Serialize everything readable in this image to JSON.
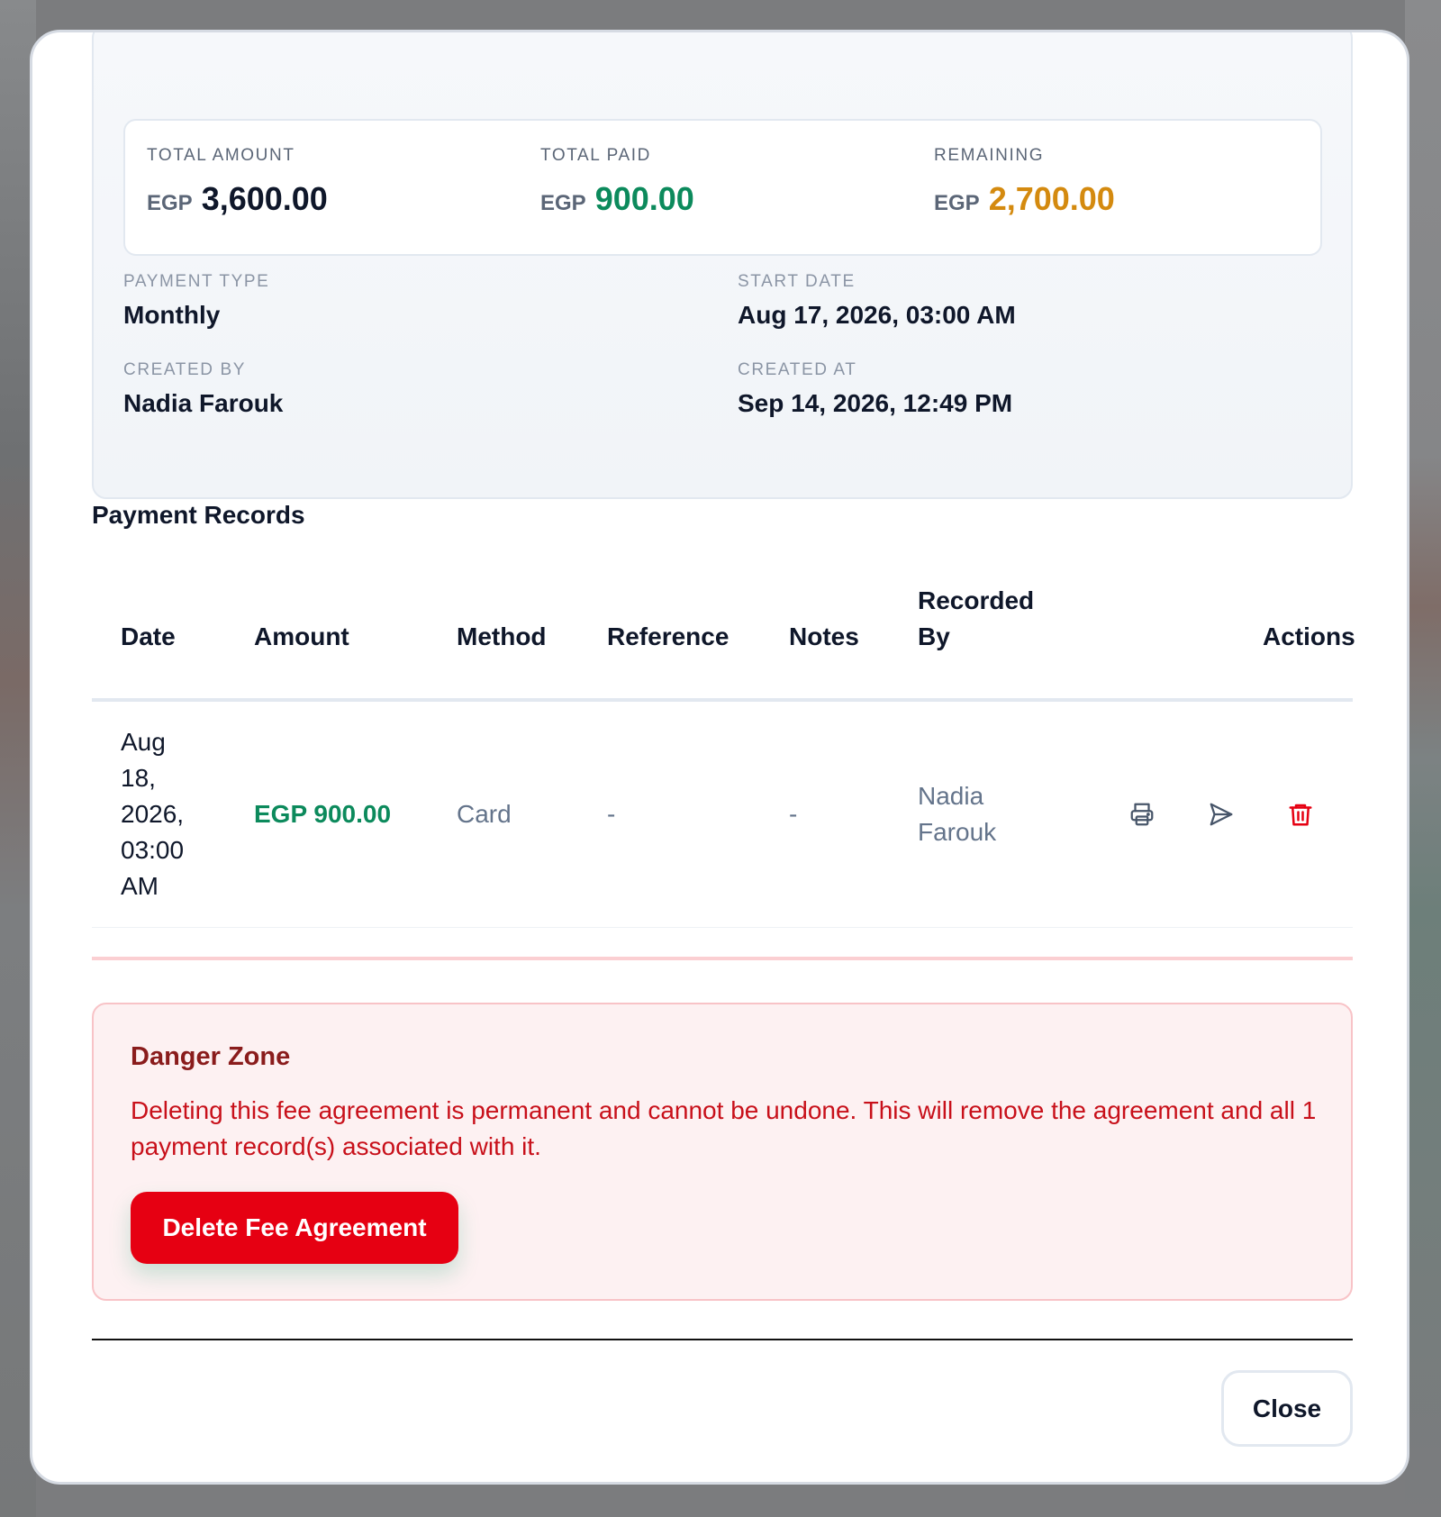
{
  "summary": {
    "totals": [
      {
        "label": "TOTAL AMOUNT",
        "currency": "EGP",
        "value": "3,600.00",
        "tone": "dark"
      },
      {
        "label": "TOTAL PAID",
        "currency": "EGP",
        "value": "900.00",
        "tone": "green"
      },
      {
        "label": "REMAINING",
        "currency": "EGP",
        "value": "2,700.00",
        "tone": "amber"
      }
    ],
    "payment_type": {
      "label": "PAYMENT TYPE",
      "value": "Monthly"
    },
    "start_date": {
      "label": "START DATE",
      "value": "Aug 17, 2026, 03:00 AM"
    },
    "created_by": {
      "label": "CREATED BY",
      "value": "Nadia Farouk"
    },
    "created_at": {
      "label": "CREATED AT",
      "value": "Sep 14, 2026, 12:49 PM"
    }
  },
  "payment_records": {
    "title": "Payment Records",
    "columns": [
      "Date",
      "Amount",
      "Method",
      "Reference",
      "Notes",
      "Recorded By",
      "Actions"
    ],
    "rows": [
      {
        "date": "Aug 18, 2026, 03:00 AM",
        "amount": "EGP 900.00",
        "method": "Card",
        "reference": "-",
        "notes": "-",
        "recorded_by": "Nadia Farouk",
        "actions": [
          "printer-icon",
          "send-icon",
          "trash-icon"
        ]
      }
    ]
  },
  "danger_zone": {
    "title": "Danger Zone",
    "text": "Deleting this fee agreement is permanent and cannot be undone. This will remove the agreement and all 1 payment record(s) associated with it.",
    "button_label": "Delete Fee Agreement"
  },
  "footer": {
    "close_label": "Close"
  },
  "colors": {
    "green": "#0c8a5c",
    "amber": "#d48a0f",
    "danger": "#e60012",
    "danger_text": "#c8101a",
    "danger_title": "#8a1c1c"
  }
}
